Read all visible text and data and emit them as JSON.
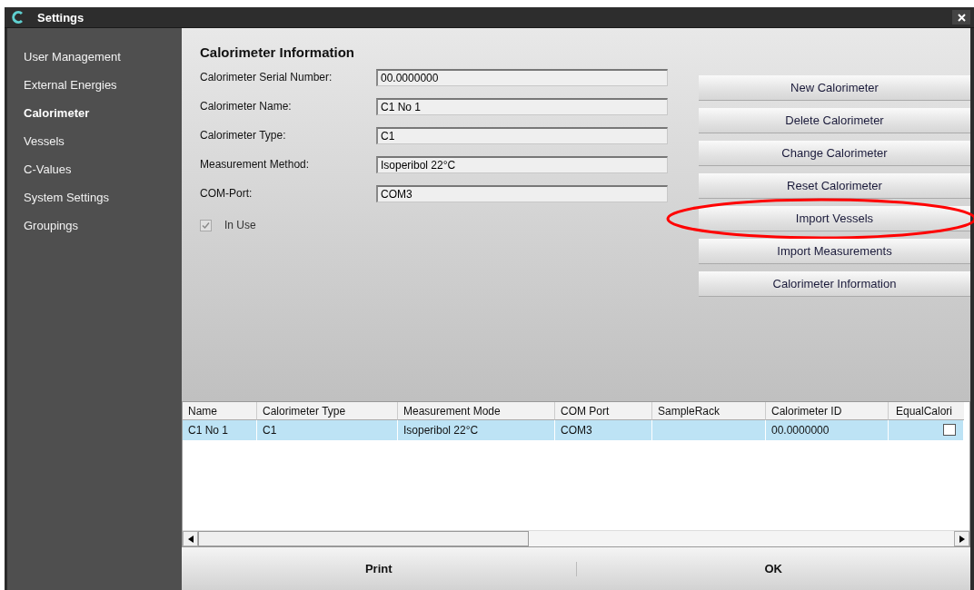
{
  "window": {
    "title": "Settings"
  },
  "sidebar": {
    "items": [
      {
        "label": "User Management",
        "selected": false
      },
      {
        "label": "External Energies",
        "selected": false
      },
      {
        "label": "Calorimeter",
        "selected": true
      },
      {
        "label": "Vessels",
        "selected": false
      },
      {
        "label": "C-Values",
        "selected": false
      },
      {
        "label": "System Settings",
        "selected": false
      },
      {
        "label": "Groupings",
        "selected": false
      }
    ]
  },
  "section_title": "Calorimeter Information",
  "fields": [
    {
      "label": "Calorimeter Serial Number:",
      "value": "00.0000000"
    },
    {
      "label": "Calorimeter Name:",
      "value": "C1 No 1"
    },
    {
      "label": "Calorimeter Type:",
      "value": "C1"
    },
    {
      "label": "Measurement Method:",
      "value": "Isoperibol 22°C"
    },
    {
      "label": "COM-Port:",
      "value": "COM3"
    }
  ],
  "in_use": {
    "label": "In Use",
    "checked": true,
    "disabled": true
  },
  "buttons": [
    {
      "label": "New Calorimeter",
      "highlighted": false
    },
    {
      "label": "Delete Calorimeter",
      "highlighted": false
    },
    {
      "label": "Change Calorimeter",
      "highlighted": false
    },
    {
      "label": "Reset Calorimeter",
      "highlighted": false
    },
    {
      "label": "Import Vessels",
      "highlighted": true
    },
    {
      "label": "Import Measurements",
      "highlighted": false
    },
    {
      "label": "Calorimeter Information",
      "highlighted": false
    }
  ],
  "table": {
    "columns": [
      "Name",
      "Calorimeter Type",
      "Measurement Mode",
      "COM Port",
      "SampleRack",
      "Calorimeter ID",
      "EqualCalori"
    ],
    "rows": [
      {
        "cells": [
          "C1 No 1",
          "C1",
          "Isoperibol 22°C",
          "COM3",
          null,
          "00.0000000"
        ],
        "checked": false,
        "selected": true
      }
    ]
  },
  "footer": {
    "buttons": [
      "Print",
      "OK"
    ]
  }
}
